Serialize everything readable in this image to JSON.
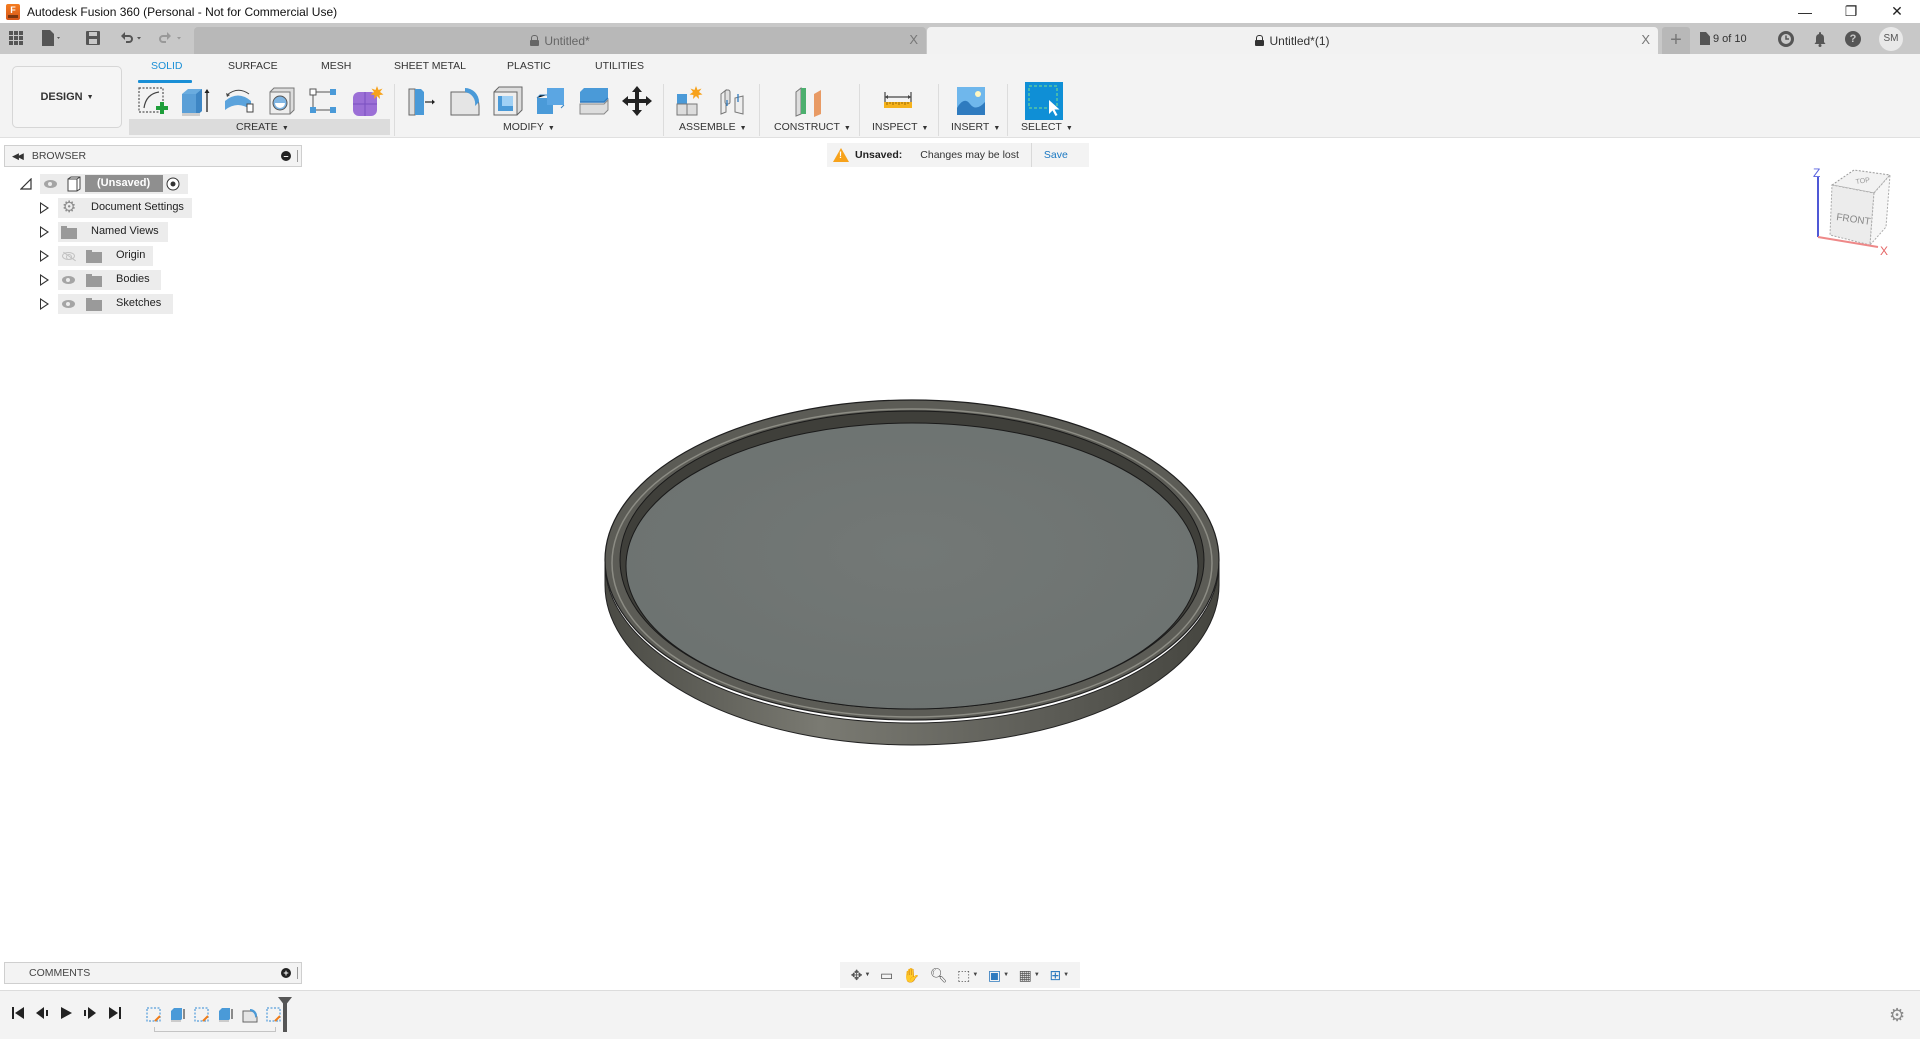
{
  "window": {
    "title": "Autodesk Fusion 360 (Personal - Not for Commercial Use)",
    "logo_letter": "F",
    "controls": {
      "minimize": "—",
      "restore": "❐",
      "close": "✕"
    }
  },
  "tabstrip": {
    "quick_access": [
      "grid-menu-icon",
      "file-icon",
      "save-icon",
      "undo-icon",
      "redo-icon"
    ],
    "tabs": [
      {
        "label": "Untitled*",
        "active": false,
        "close": "X"
      },
      {
        "label": "Untitled*(1)",
        "active": true,
        "close": "X"
      }
    ],
    "new_tab": "+",
    "jobs_label": "9 of 10",
    "avatar_initials": "SM",
    "help_glyph": "?"
  },
  "ribbon": {
    "workspace_label": "DESIGN",
    "tabs": [
      "SOLID",
      "SURFACE",
      "MESH",
      "SHEET METAL",
      "PLASTIC",
      "UTILITIES"
    ],
    "active_tab": "SOLID",
    "groups": [
      {
        "label": "CREATE",
        "tools": [
          "create-sketch",
          "extrude",
          "revolve",
          "hole",
          "pattern",
          "create-form"
        ]
      },
      {
        "label": "MODIFY",
        "tools": [
          "press-pull",
          "fillet",
          "shell",
          "combine",
          "offset-face",
          "move-copy"
        ]
      },
      {
        "label": "ASSEMBLE",
        "tools": [
          "new-component",
          "joint"
        ]
      },
      {
        "label": "CONSTRUCT",
        "tools": [
          "offset-plane"
        ]
      },
      {
        "label": "INSPECT",
        "tools": [
          "measure"
        ]
      },
      {
        "label": "INSERT",
        "tools": [
          "insert-image"
        ]
      },
      {
        "label": "SELECT",
        "tools": [
          "window-select"
        ]
      }
    ],
    "accent": "#1a8fd6"
  },
  "browser": {
    "title": "BROWSER",
    "root": {
      "label": "(Unsaved)"
    },
    "items": [
      {
        "label": "Document Settings",
        "icon": "gear-icon",
        "visible": null
      },
      {
        "label": "Named Views",
        "icon": "folder-icon",
        "visible": null
      },
      {
        "label": "Origin",
        "icon": "folder-icon",
        "visible": false
      },
      {
        "label": "Bodies",
        "icon": "folder-icon",
        "visible": true
      },
      {
        "label": "Sketches",
        "icon": "folder-icon",
        "visible": true
      }
    ]
  },
  "notice": {
    "title": "Unsaved:",
    "message": "Changes may be lost",
    "action": "Save"
  },
  "viewcube": {
    "top": "TOP",
    "front": "FRONT",
    "axis_z": "Z",
    "axis_x": "X"
  },
  "comments": {
    "title": "COMMENTS"
  },
  "navbar": [
    "orbit",
    "look-at",
    "pan",
    "zoom",
    "fit",
    "display-settings",
    "grid-settings",
    "viewports"
  ],
  "timeline": {
    "controls": [
      "go-to-start",
      "step-back",
      "play",
      "step-forward",
      "go-to-end"
    ],
    "features": [
      "sketch",
      "extrude",
      "sketch",
      "extrude",
      "fillet",
      "sketch"
    ]
  }
}
